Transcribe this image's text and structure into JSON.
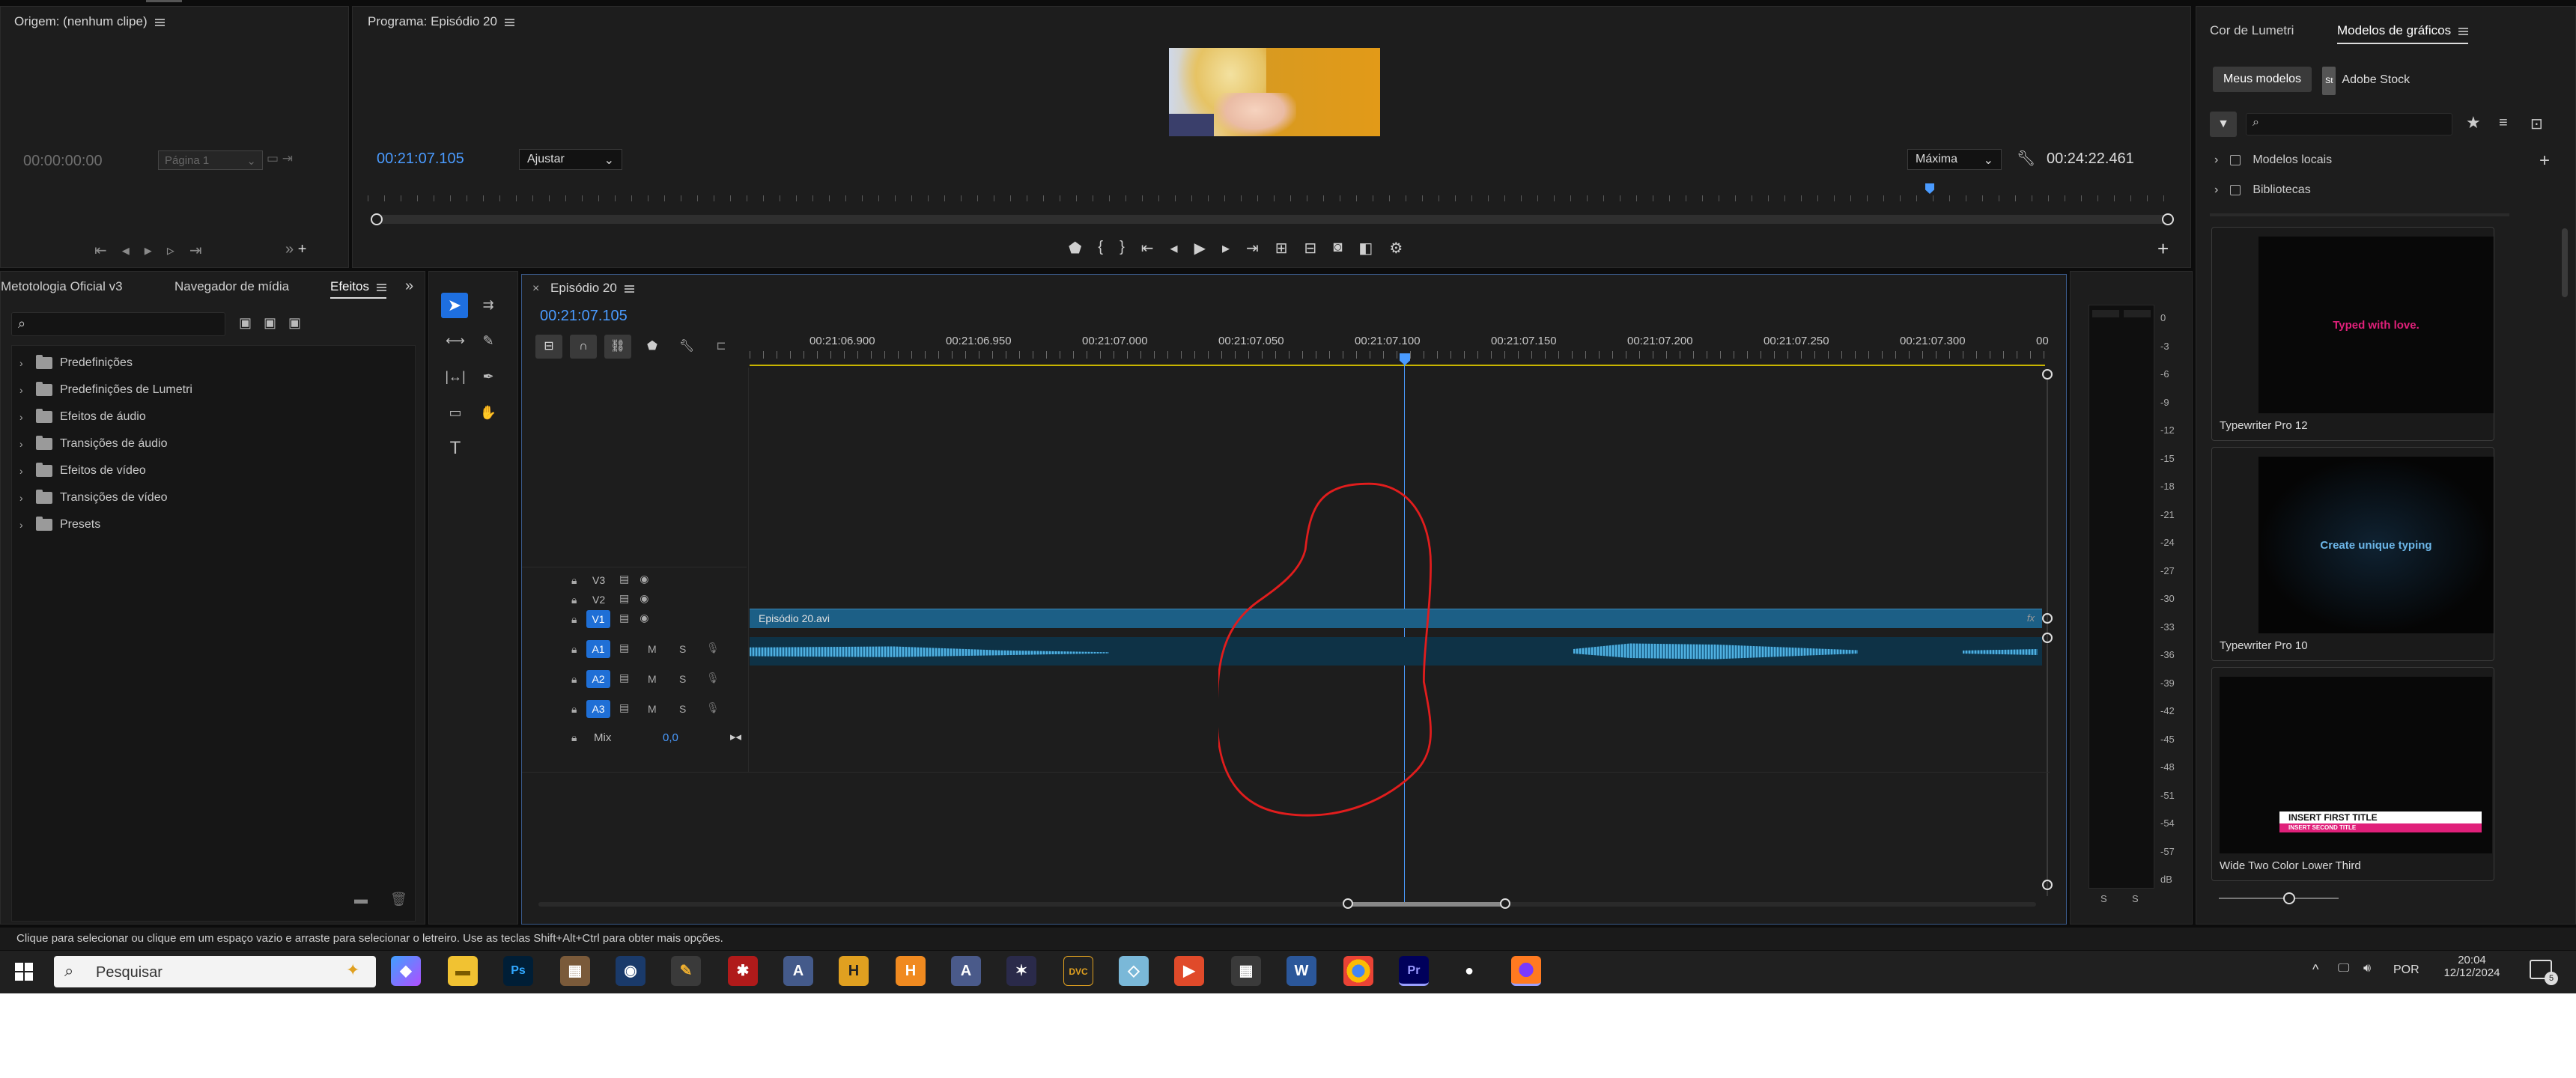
{
  "source": {
    "title": "Origem: (nenhum clipe)",
    "timecode": "00:00:00:00",
    "page": "Página 1"
  },
  "program": {
    "title": "Programa: Episódio 20",
    "timecode": "00:21:07.105",
    "fit": "Ajustar",
    "quality": "Máxima",
    "duration": "00:24:22.461"
  },
  "effects_panel": {
    "tabs": [
      "Metotologia Oficial v3",
      "Navegador de mídia",
      "Efeitos"
    ],
    "items": [
      "Predefinições",
      "Predefinições de Lumetri",
      "Efeitos de áudio",
      "Transições de áudio",
      "Efeitos de vídeo",
      "Transições de vídeo",
      "Presets"
    ]
  },
  "timeline": {
    "tab": "Episódio 20",
    "close": "×",
    "timecode": "00:21:07.105",
    "ruler": [
      "00:21:06.900",
      "00:21:06.950",
      "00:21:07.000",
      "00:21:07.050",
      "00:21:07.100",
      "00:21:07.150",
      "00:21:07.200",
      "00:21:07.250",
      "00:21:07.300",
      "00"
    ],
    "video_tracks": [
      "V3",
      "V2",
      "V1"
    ],
    "audio_tracks": [
      "A1",
      "A2",
      "A3"
    ],
    "track_mute": "M",
    "track_solo": "S",
    "mix_label": "Mix",
    "mix_value": "0,0",
    "clip_name": "Episódio 20.avi",
    "fx_badge": "fx"
  },
  "meter": {
    "labels": [
      "0",
      "-3",
      "-6",
      "-9",
      "-12",
      "-15",
      "-18",
      "-21",
      "-24",
      "-27",
      "-30",
      "-33",
      "-36",
      "-39",
      "-42",
      "-45",
      "-48",
      "-51",
      "-54",
      "-57",
      "dB"
    ],
    "solo": [
      "S",
      "S"
    ]
  },
  "graphics": {
    "tabs": [
      "Cor de Lumetri",
      "Modelos de gráficos"
    ],
    "subtabs": [
      "Meus modelos",
      "Adobe Stock"
    ],
    "st_badge": "St",
    "tree": [
      "Modelos locais",
      "Bibliotecas"
    ],
    "templates": [
      {
        "name": "Typewriter Pro 12",
        "preview": "Typed with love.",
        "color": "#e0207a"
      },
      {
        "name": "Typewriter Pro 10",
        "preview": "Create unique typing",
        "color": "#5aa8e0"
      },
      {
        "name": "Wide Two Color Lower Third",
        "line1": "INSERT FIRST TITLE",
        "line2": "INSERT SECOND TITLE"
      }
    ]
  },
  "status_bar": "Clique para selecionar ou clique em um espaço vazio e arraste para selecionar o letreiro. Use as teclas Shift+Alt+Ctrl para obter mais opções.",
  "taskbar": {
    "search": "Pesquisar",
    "lang": "POR",
    "time": "20:04",
    "date": "12/12/2024",
    "notif": "5"
  },
  "icons": [
    "windows-icon",
    "search-icon",
    "copilot-icon",
    "file-explorer-icon",
    "photoshop-icon",
    "chrome-icon",
    "premiere-icon",
    "firefox-icon",
    "calculator-icon",
    "word-icon"
  ]
}
